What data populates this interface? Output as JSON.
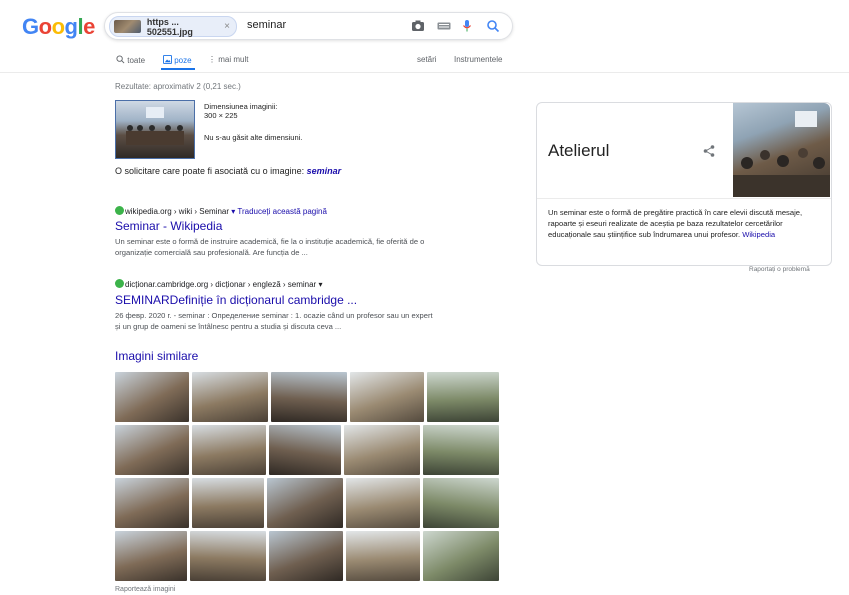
{
  "logo": {
    "text": "Google"
  },
  "search": {
    "chip_label": "https ... 502551.jpg",
    "chip_close": "×",
    "query": "seminar"
  },
  "tabs": {
    "all": "toate",
    "images": "poze",
    "more": "mai mult",
    "settings": "setări",
    "tools": "Instrumentele"
  },
  "results": {
    "stats": "Rezultate: aproximativ 2 (0,21 sec.)",
    "image_size_label": "Dimensiunea imaginii:",
    "image_size": "300 × 225",
    "no_other_sizes": "Nu s-au găsit alte dimensiuni.",
    "suggestion_prefix": "O solicitare care poate fi asociată cu o imagine:",
    "suggestion_query": "seminar",
    "items": [
      {
        "url": "wikipedia.org › wiki › Seminar",
        "translate": "▾ Traduceți această pagină",
        "title": "Seminar - Wikipedia",
        "desc_line1": "Un seminar este o formă de instruire academică, fie la o instituție academică, fie oferită de o",
        "desc_line2": "organizație comercială sau profesională. Are funcția de ..."
      },
      {
        "url": "dicționar.cambridge.org › dicționar › engleză › seminar",
        "translate": "▾",
        "title": "SEMINARDefiniție în dicționarul cambridge ...",
        "desc_line1": "26 февр. 2020 г. - seminar : Определение seminar : 1. ocazie când un profesor sau un expert",
        "desc_line2": "și un grup de oameni se întâlnesc pentru a studia și discuta ceva ..."
      }
    ],
    "similar_title": "Imagini similare",
    "report_images": "Raportează imagini"
  },
  "knowledge_panel": {
    "title": "Atelierul",
    "description": "Un seminar este o formă de pregătire practică în care elevii discută mesaje, rapoarte și eseuri realizate de aceștia pe baza rezultatelor cercetărilor educaționale sau științifice sub îndrumarea unui profesor.",
    "source": "Wikipedia",
    "report": "Raportați o problemă"
  },
  "colors": {
    "link": "#1a0dab",
    "accent": "#1a73e8",
    "google_blue": "#4285f4",
    "google_red": "#ea4335",
    "google_yellow": "#fbbc05",
    "google_green": "#34a853"
  }
}
